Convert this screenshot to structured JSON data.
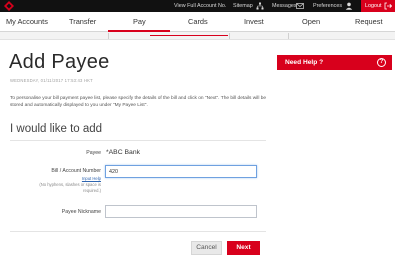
{
  "topbar": {
    "view_full_account": "View Full Account No.",
    "sitemap": "Sitemap",
    "messages": "Messages",
    "preferences": "Preferences",
    "logout": "Logout"
  },
  "nav": {
    "items": [
      "My Accounts",
      "Transfer",
      "Pay",
      "Cards",
      "Invest",
      "Open",
      "Request"
    ],
    "active": "Pay"
  },
  "page": {
    "title": "Add Payee",
    "date": "WEDNESDAY, 01/11/2017 17:53:43 HKT",
    "intro": "To personalise your bill payment payee list, please specify the details of the bill and click on \"Next\". The bill details will be stored and automatically displayed to you under \"My Payee List\".",
    "section_title": "I would like to add"
  },
  "form": {
    "payee_label": "Payee",
    "payee_value": "*ABC Bank",
    "account_label": "Bill / Account Number",
    "input_help": "Input Help",
    "account_hint_1": "(No hyphens, slashes or space is",
    "account_hint_2": "required.)",
    "account_value": "420",
    "nickname_label": "Payee Nickname",
    "nickname_value": ""
  },
  "actions": {
    "cancel": "Cancel",
    "next": "Next"
  },
  "help": {
    "label": "Need Help ?",
    "icon_text": "?"
  },
  "colors": {
    "brand_red": "#d8001c",
    "topbar": "#111111"
  }
}
